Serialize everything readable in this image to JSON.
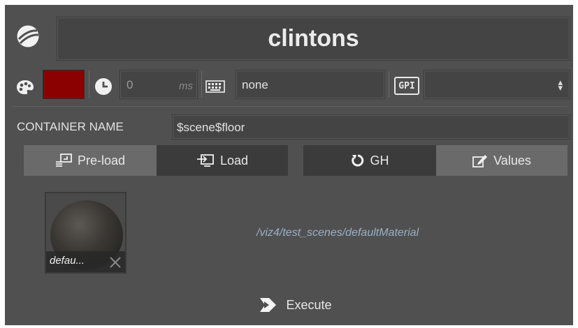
{
  "header": {
    "title": "clintons"
  },
  "controls": {
    "color_swatch": "#8b0000",
    "delay_value": "0",
    "delay_unit": "ms",
    "keyboard_value": "none",
    "gpi_label": "GPI",
    "gpi_select_value": ""
  },
  "container": {
    "label": "CONTAINER NAME",
    "value": "$scene$floor"
  },
  "buttons": {
    "preload": "Pre-load",
    "load": "Load",
    "gh": "GH",
    "values": "Values",
    "execute": "Execute"
  },
  "material": {
    "thumb_label": "defau...",
    "path": "/viz4/test_scenes/defaultMaterial"
  },
  "colors": {
    "panel_bg": "#505050",
    "field_bg": "#444444",
    "button_light": "#6a6a6a",
    "button_dark": "#3b3b3b",
    "path_text": "#9ab0c8"
  }
}
